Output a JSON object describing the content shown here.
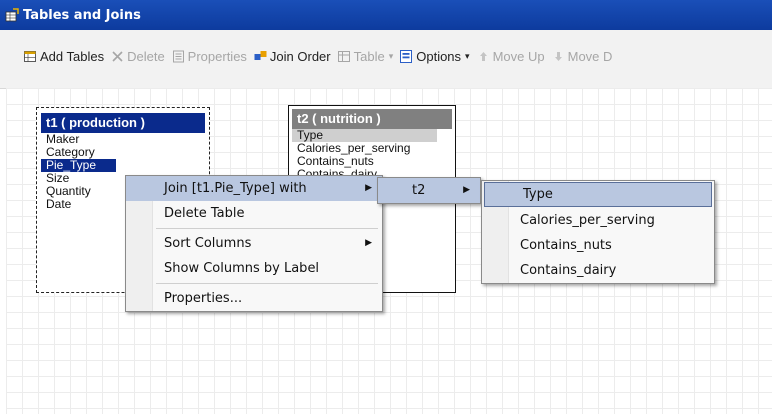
{
  "window": {
    "title": "Tables and Joins"
  },
  "toolbar": {
    "items": [
      {
        "label": "Add Tables",
        "icon": "table-add-icon",
        "enabled": true
      },
      {
        "label": "Delete",
        "icon": "x-delete-icon",
        "enabled": false
      },
      {
        "label": "Properties",
        "icon": "properties-icon",
        "enabled": false
      },
      {
        "label": "Join Order",
        "icon": "join-order-icon",
        "enabled": true
      },
      {
        "label": "Table",
        "icon": "table-icon",
        "enabled": false
      },
      {
        "label": "Options",
        "icon": "options-icon",
        "enabled": true
      },
      {
        "label": "Move Up",
        "icon": "arrow-up-icon",
        "enabled": false
      },
      {
        "label": "Move D",
        "icon": "arrow-down-icon",
        "enabled": false
      }
    ],
    "dropdown_glyph": "▾"
  },
  "tables": {
    "t1": {
      "title": "t1 ( production )",
      "columns": [
        "Maker",
        "Category",
        "Pie_Type",
        "Size",
        "Quantity",
        "Date"
      ],
      "selected": "Pie_Type"
    },
    "t2": {
      "title": "t2 ( nutrition )",
      "columns": [
        "Type",
        "Calories_per_serving",
        "Contains_nuts",
        "Contains_dairy"
      ],
      "highlighted": "Type"
    }
  },
  "context_menu": {
    "items": [
      {
        "label": "Join [t1.Pie_Type] with",
        "submenu": true,
        "active": true
      },
      {
        "label": "Delete Table",
        "submenu": false
      },
      {
        "label": "Sort Columns",
        "submenu": true
      },
      {
        "label": "Show Columns by Label",
        "submenu": false
      },
      {
        "label": "Properties...",
        "submenu": false
      }
    ],
    "submenu_arrow": "▶"
  },
  "submenu_tables": {
    "items": [
      {
        "label": "t2",
        "submenu": true,
        "active": true
      }
    ]
  },
  "submenu_columns": {
    "items": [
      {
        "label": "Type",
        "active": true
      },
      {
        "label": "Calories_per_serving"
      },
      {
        "label": "Contains_nuts"
      },
      {
        "label": "Contains_dairy"
      }
    ]
  },
  "colors": {
    "title_bar": "#0d3b9e",
    "t1_header": "#0a2a8c",
    "t2_header": "#808080",
    "menu_highlight": "#b9c7e0"
  }
}
